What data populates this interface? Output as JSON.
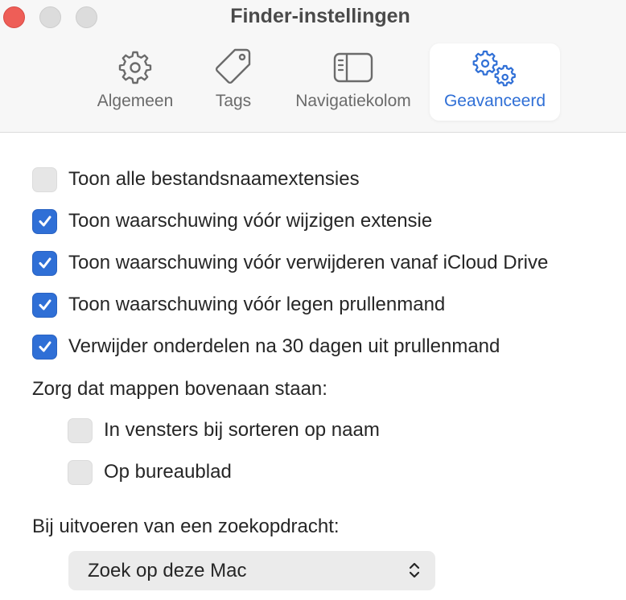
{
  "window": {
    "title": "Finder-instellingen"
  },
  "tabs": [
    {
      "label": "Algemeen",
      "icon": "gear-icon",
      "active": false
    },
    {
      "label": "Tags",
      "icon": "tag-icon",
      "active": false
    },
    {
      "label": "Navigatiekolom",
      "icon": "sidebar-icon",
      "active": false
    },
    {
      "label": "Geavanceerd",
      "icon": "gears-icon",
      "active": true
    }
  ],
  "options": {
    "show_extensions": {
      "label": "Toon alle bestandsnaamextensies",
      "checked": false
    },
    "warn_extension_change": {
      "label": "Toon waarschuwing vóór wijzigen extensie",
      "checked": true
    },
    "warn_icloud_remove": {
      "label": "Toon waarschuwing vóór verwijderen vanaf iCloud Drive",
      "checked": true
    },
    "warn_empty_trash": {
      "label": "Toon waarschuwing vóór legen prullenmand",
      "checked": true
    },
    "remove_after_30": {
      "label": "Verwijder onderdelen na 30 dagen uit prullenmand",
      "checked": true
    }
  },
  "folders_on_top": {
    "heading": "Zorg dat mappen bovenaan staan:",
    "in_windows": {
      "label": "In vensters bij sorteren op naam",
      "checked": false
    },
    "on_desktop": {
      "label": "Op bureaublad",
      "checked": false
    }
  },
  "search": {
    "heading": "Bij uitvoeren van een zoekopdracht:",
    "selected": "Zoek op deze Mac"
  },
  "colors": {
    "accent": "#2f6fd6",
    "close": "#ee5e57"
  }
}
